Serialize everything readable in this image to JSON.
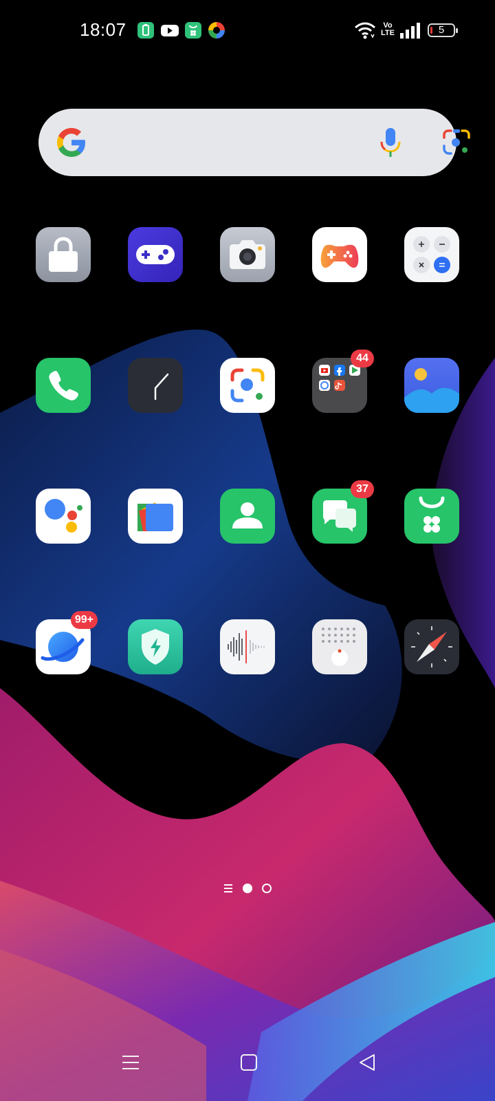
{
  "status_bar": {
    "time": "18:07",
    "notification_icons": [
      "battery-saver-app-icon",
      "youtube-icon",
      "store-icon",
      "photos-icon"
    ],
    "signal_label": "Vo LTE",
    "battery_level": "5"
  },
  "search_bar": {
    "icons": [
      "google-logo",
      "mic-icon",
      "google-lens-icon"
    ]
  },
  "apps": [
    {
      "name": "lock-app",
      "icon": "lock-icon"
    },
    {
      "name": "game-space",
      "icon": "gamepad-icon"
    },
    {
      "name": "camera",
      "icon": "camera-icon"
    },
    {
      "name": "games",
      "icon": "game-controller-icon"
    },
    {
      "name": "calculator",
      "icon": "calculator-icon"
    },
    {
      "name": "phone",
      "icon": "phone-icon"
    },
    {
      "name": "clock",
      "icon": "clock-icon"
    },
    {
      "name": "google-lens",
      "icon": "lens-icon"
    },
    {
      "name": "folder",
      "icon": "folder-icon",
      "badge": "44"
    },
    {
      "name": "gallery",
      "icon": "gallery-icon"
    },
    {
      "name": "google-assistant",
      "icon": "assistant-icon"
    },
    {
      "name": "files",
      "icon": "files-icon"
    },
    {
      "name": "contacts",
      "icon": "contacts-icon"
    },
    {
      "name": "messages",
      "icon": "messages-icon",
      "badge": "37"
    },
    {
      "name": "app-market",
      "icon": "app-market-icon"
    },
    {
      "name": "browser",
      "icon": "browser-icon",
      "badge": "99+"
    },
    {
      "name": "phone-manager",
      "icon": "shield-icon"
    },
    {
      "name": "recorder",
      "icon": "sound-wave-icon"
    },
    {
      "name": "theme-store",
      "icon": "dots-icon"
    },
    {
      "name": "compass",
      "icon": "compass-icon"
    }
  ],
  "pager": {
    "pages": 2,
    "current": 1
  },
  "nav_bar": {
    "buttons": [
      "menu-icon",
      "home-icon",
      "back-icon"
    ]
  }
}
